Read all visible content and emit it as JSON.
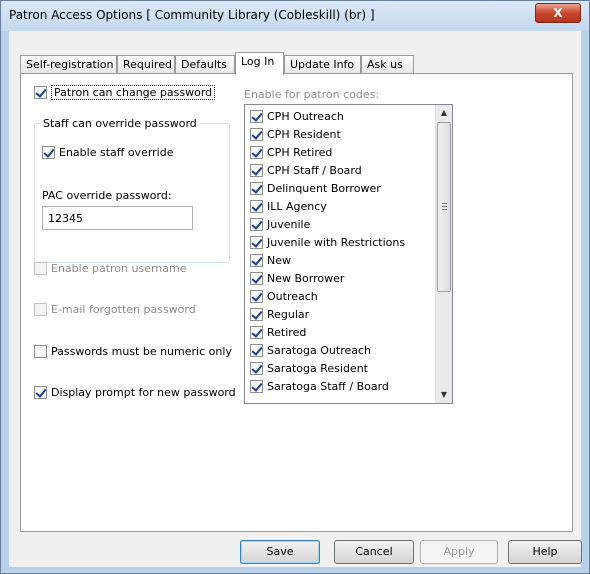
{
  "window": {
    "title": "Patron Access Options [ Community Library (Cobleskill) (br) ]",
    "close_label": "X"
  },
  "tabs": [
    {
      "label": "Self-registration",
      "active": false
    },
    {
      "label": "Required",
      "active": false
    },
    {
      "label": "Defaults",
      "active": false
    },
    {
      "label": "Log In",
      "active": true
    },
    {
      "label": "Update Info",
      "active": false
    },
    {
      "label": "Ask us",
      "active": false
    }
  ],
  "login": {
    "patron_change_password": {
      "label": "Patron can change password",
      "checked": true
    },
    "staff_override_group_title": "Staff can override password",
    "enable_staff_override": {
      "label": "Enable staff override",
      "checked": true
    },
    "pac_override_label": "PAC override password:",
    "pac_override_value": "12345",
    "enable_patron_username": {
      "label": "Enable patron username",
      "checked": false,
      "enabled": false
    },
    "email_forgotten_password": {
      "label": "E-mail forgotten password",
      "checked": false,
      "enabled": false
    },
    "passwords_numeric_only": {
      "label": "Passwords must be numeric only",
      "checked": false
    },
    "display_prompt_new_password": {
      "label": "Display prompt for new password",
      "checked": true
    },
    "patron_codes_label": "Enable for patron codes:",
    "patron_codes": [
      {
        "label": "CPH Outreach",
        "checked": true
      },
      {
        "label": "CPH Resident",
        "checked": true
      },
      {
        "label": "CPH Retired",
        "checked": true
      },
      {
        "label": "CPH Staff / Board",
        "checked": true
      },
      {
        "label": "Delinquent Borrower",
        "checked": true
      },
      {
        "label": "ILL Agency",
        "checked": true
      },
      {
        "label": "Juvenile",
        "checked": true
      },
      {
        "label": "Juvenile with Restrictions",
        "checked": true
      },
      {
        "label": "New",
        "checked": true
      },
      {
        "label": "New Borrower",
        "checked": true
      },
      {
        "label": "Outreach",
        "checked": true
      },
      {
        "label": "Regular",
        "checked": true
      },
      {
        "label": "Retired",
        "checked": true
      },
      {
        "label": "Saratoga Outreach",
        "checked": true
      },
      {
        "label": "Saratoga Resident",
        "checked": true
      },
      {
        "label": "Saratoga Staff / Board",
        "checked": true
      }
    ]
  },
  "buttons": {
    "save": "Save",
    "cancel": "Cancel",
    "apply": "Apply",
    "help": "Help"
  }
}
